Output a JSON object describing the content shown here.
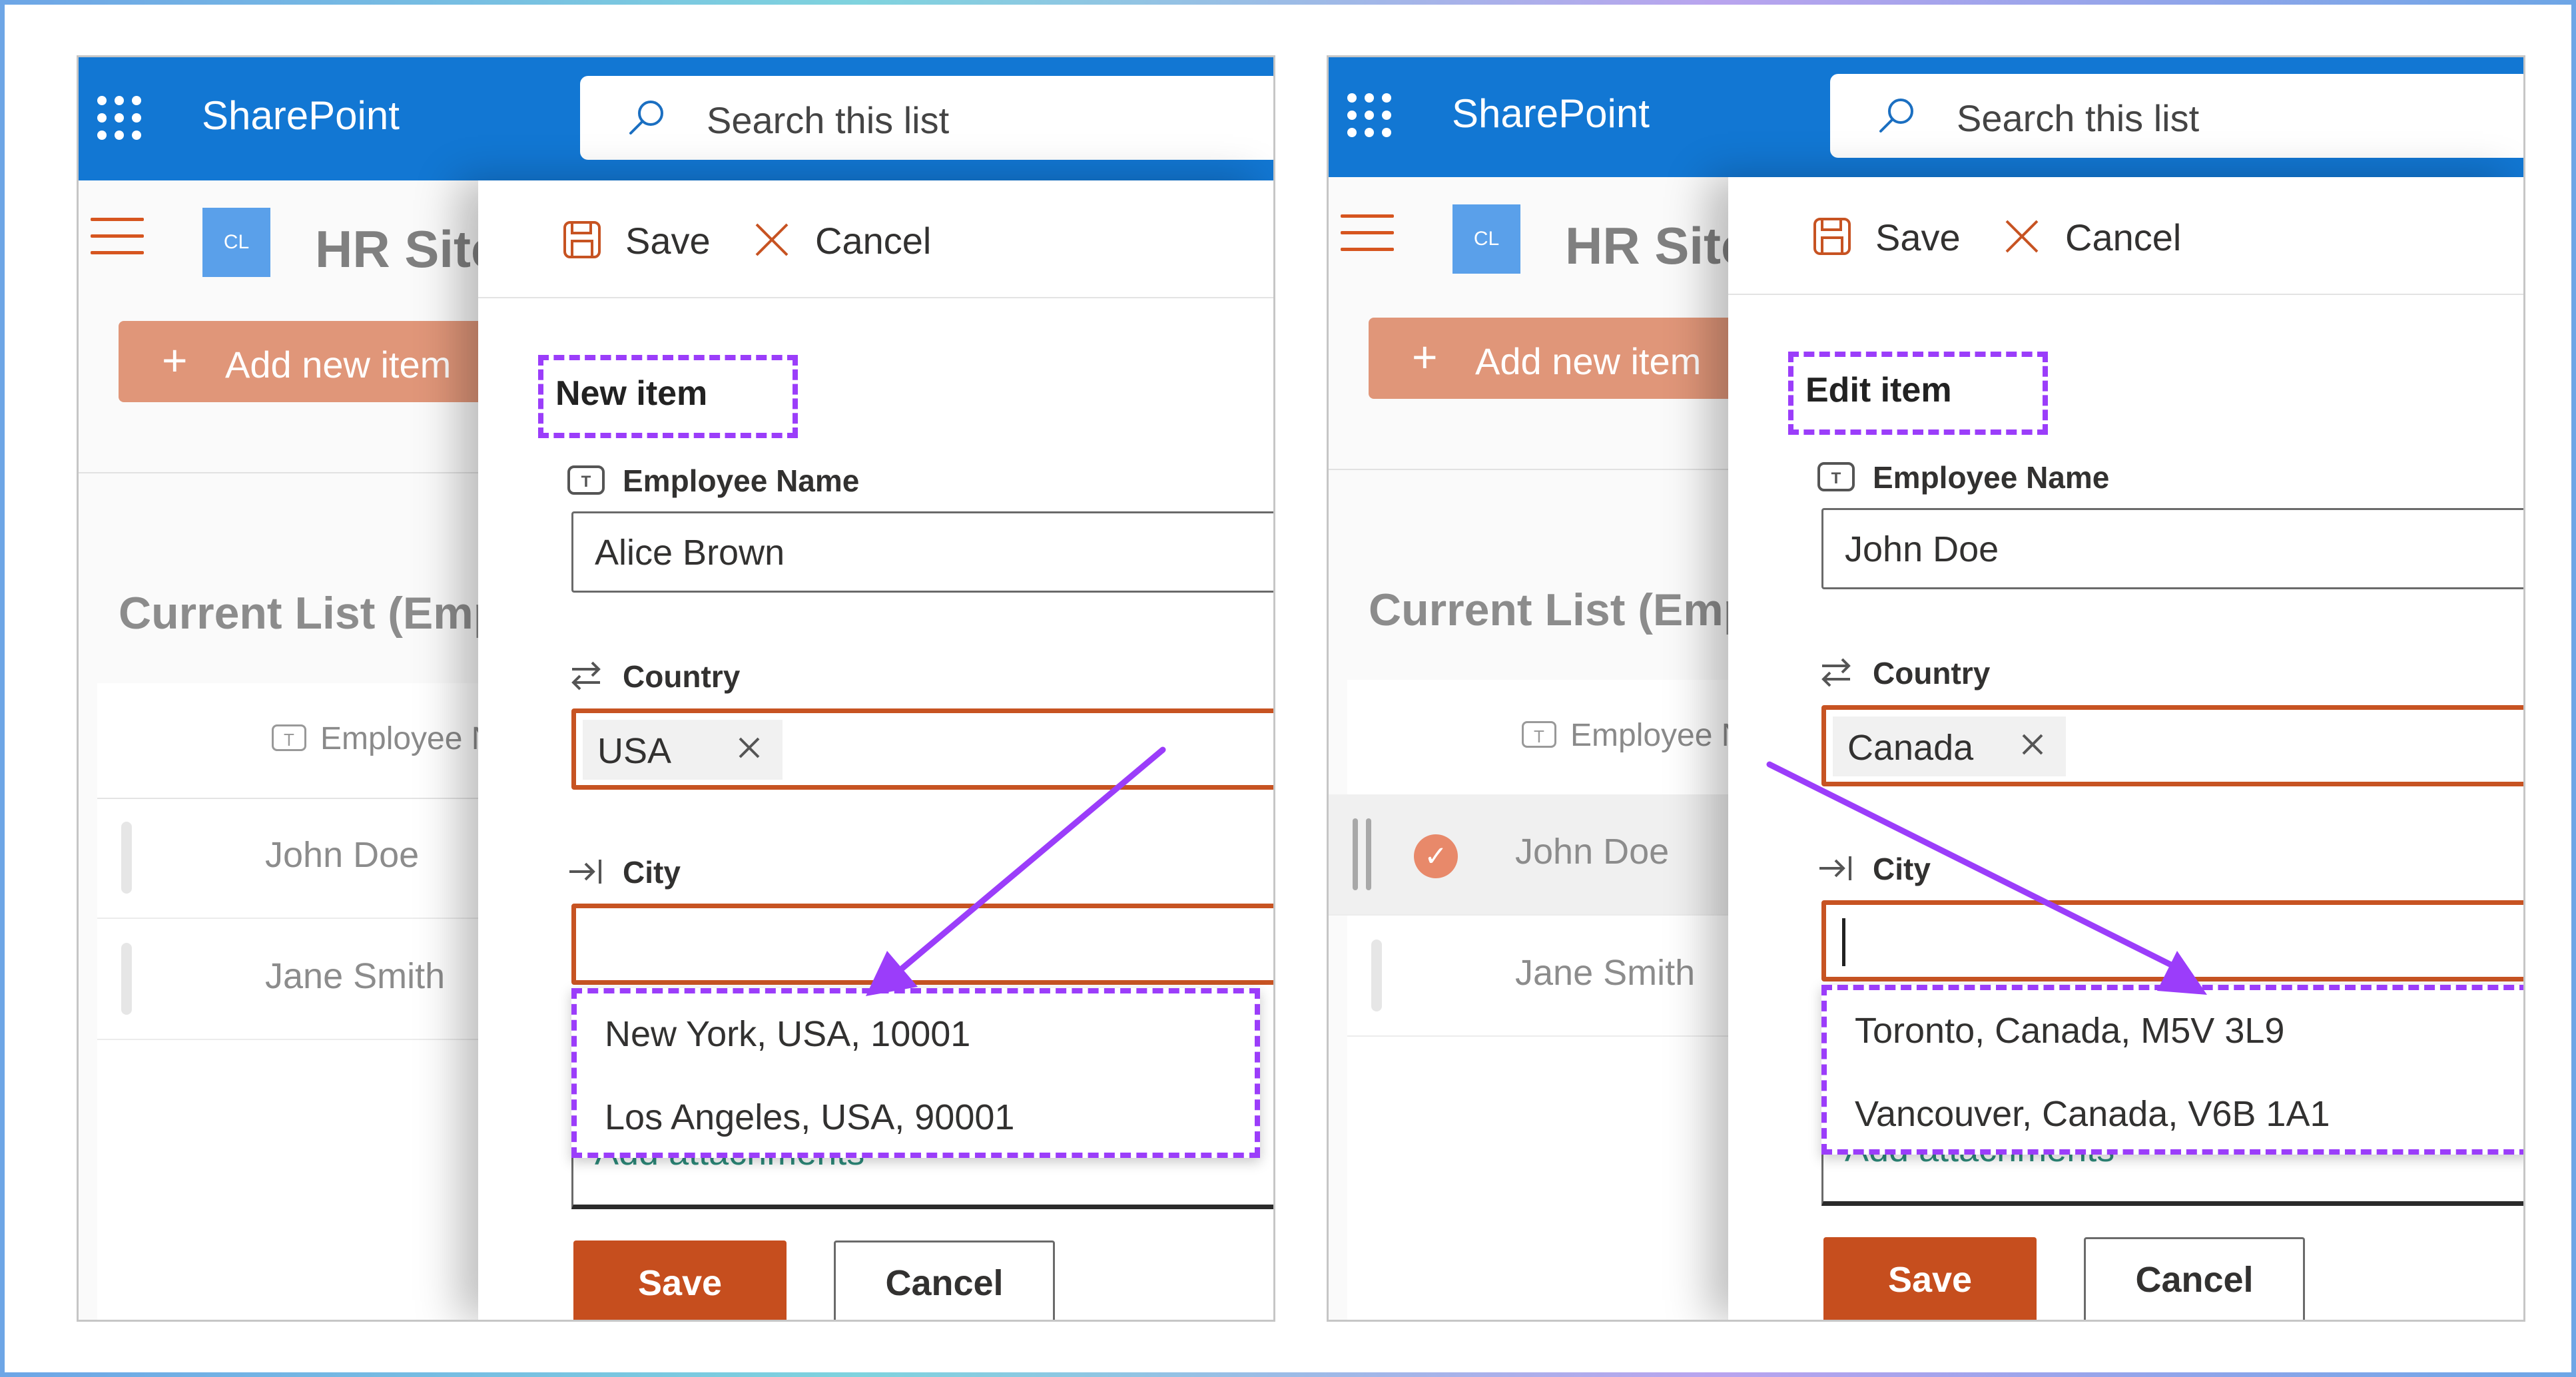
{
  "colors": {
    "accent_orange": "#c64e1e",
    "highlight_purple": "#9b3dfa",
    "topbar_blue": "#1277d3"
  },
  "panels": [
    {
      "topbar": {
        "brand": "SharePoint",
        "search_placeholder": "Search this list",
        "waffle_icon": "waffle-icon",
        "search_icon": "search-icon"
      },
      "site": {
        "badge": "CL",
        "title": "HR Site"
      },
      "add_new_label": "Add new item",
      "list_title": "Current List (Employees)",
      "column_header": "Employee Name",
      "rows": [
        "John Doe",
        "Jane Smith"
      ],
      "commands": {
        "save": "Save",
        "cancel": "Cancel"
      },
      "form_title": "New item",
      "fields": {
        "name_label": "Employee Name",
        "name_value": "Alice Brown",
        "country_label": "Country",
        "country_value": "USA",
        "city_label": "City",
        "city_value": ""
      },
      "attachments": "Add attachments",
      "suggestions": [
        "New York, USA, 10001",
        "Los Angeles, USA, 90001"
      ],
      "buttons": {
        "save": "Save",
        "cancel": "Cancel"
      }
    },
    {
      "topbar": {
        "brand": "SharePoint",
        "search_placeholder": "Search this list",
        "waffle_icon": "waffle-icon",
        "search_icon": "search-icon"
      },
      "site": {
        "badge": "CL",
        "title": "HR Site"
      },
      "add_new_label": "Add new item",
      "list_title": "Current List (Employees)",
      "column_header": "Employee Name",
      "rows": [
        "John Doe",
        "Jane Smith"
      ],
      "selected_row": "John Doe",
      "commands": {
        "save": "Save",
        "cancel": "Cancel"
      },
      "form_title": "Edit item",
      "fields": {
        "name_label": "Employee Name",
        "name_value": "John Doe",
        "country_label": "Country",
        "country_value": "Canada",
        "city_label": "City",
        "city_value": ""
      },
      "attachments": "Add attachments",
      "suggestions": [
        "Toronto, Canada, M5V 3L9",
        "Vancouver, Canada, V6B 1A1"
      ],
      "buttons": {
        "save": "Save",
        "cancel": "Cancel"
      }
    }
  ]
}
